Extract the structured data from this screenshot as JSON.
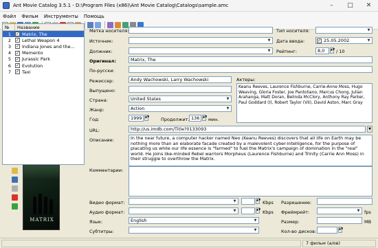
{
  "window": {
    "title": "Ant Movie Catalog 3.5.1 - D:\\Program Files (x86)\\Ant Movie Catalog\\Catalogs\\sample.amc"
  },
  "menu": [
    "Файл",
    "Фильм",
    "Инструменты",
    "Помощь"
  ],
  "list": {
    "headers": {
      "num": "№",
      "name": "Название"
    },
    "rows": [
      {
        "num": "1",
        "checked": "✓",
        "name": "Matrix, The"
      },
      {
        "num": "2",
        "checked": "✓",
        "name": "Lethal Weapon 4"
      },
      {
        "num": "3",
        "checked": "✓",
        "name": "Indiana Jones and the..."
      },
      {
        "num": "4",
        "checked": "✓",
        "name": "Memento"
      },
      {
        "num": "5",
        "checked": "✓",
        "name": "Jurassic Park"
      },
      {
        "num": "6",
        "checked": "✓",
        "name": "Evolution"
      },
      {
        "num": "7",
        "checked": "✓",
        "name": "Taxi"
      }
    ]
  },
  "poster": {
    "title": "MATRIX"
  },
  "form": {
    "media_label": {
      "label": "Метка носителя:",
      "value": ""
    },
    "source": {
      "label": "Источник:",
      "value": ""
    },
    "borrower": {
      "label": "Должник:",
      "value": ""
    },
    "media_type": {
      "label": "Тип носителя:",
      "value": ""
    },
    "date_added": {
      "label": "Дата ввода:",
      "value": "25.05.2002",
      "checked": "✓"
    },
    "rating": {
      "label": "Рейтинг:",
      "value": "8,0",
      "suffix": "/ 10"
    },
    "original": {
      "label": "Оригинал:",
      "value": "Matrix, The"
    },
    "translated": {
      "label": "По-русски:",
      "value": ""
    },
    "director": {
      "label": "Режиссер:",
      "value": "Andy Wachowski, Larry Wachowski"
    },
    "producer": {
      "label": "Выпущено:",
      "value": ""
    },
    "country": {
      "label": "Страна:",
      "value": "United States"
    },
    "genre": {
      "label": "Жанр:",
      "value": "Action"
    },
    "year": {
      "label": "Год:",
      "value": "1999"
    },
    "length": {
      "label": "Продолжит.:",
      "value": "136",
      "unit": "мин."
    },
    "url": {
      "label": "URL:",
      "value": "http://us.imdb.com/Title?0133093"
    },
    "actors": {
      "label": "Актеры:",
      "value": "Keanu Reeves, Laurence Fishburne, Carrie-Anne Moss, Hugo Weaving, Gloria Foster, Joe Pantoliano, Marcus Chong, Julian Arahanga, Matt Doran, Belinda McClory, Anthony Ray Parker, Paul Goddard (I), Robert Taylor (VII), David Aston, Marc Gray"
    },
    "description": {
      "label": "Описание:",
      "value": "In the near future, a computer hacker named Neo (Keanu Reeves) discovers that all life on Earth may be nothing more than an elaborate facade created by a malevolent cyber-intelligence, for the purpose of placating us while our life essence is \"farmed\" to fuel the Matrix's campaign of domination in the \"real\" world. He joins like-minded Rebel warriors Morpheus (Laurence Fishburne) and Trinity (Carrie Ann Moss) in their struggle to overthrow the Matrix."
    },
    "comments": {
      "label": "Комментарии:",
      "value": ""
    },
    "video_format": {
      "label": "Видео формат:",
      "value": "",
      "unit": "Kbps"
    },
    "audio_format": {
      "label": "Аудио формат:",
      "value": "",
      "unit": "Kbps"
    },
    "languages": {
      "label": "Язык:",
      "value": "English"
    },
    "subtitles": {
      "label": "Субтитры:",
      "value": ""
    },
    "resolution": {
      "label": "Разрешение:",
      "value": ""
    },
    "framerate": {
      "label": "Фреймрейт:",
      "value": "",
      "unit": "fps"
    },
    "size": {
      "label": "Размер:",
      "value": "",
      "unit": "MB"
    },
    "discs": {
      "label": "Кол-во дисков:",
      "value": ""
    }
  },
  "status": {
    "count": "7 фильм (a/ов)"
  },
  "colors": {
    "selection": "#316ac5",
    "window_bg": "#ece9d8",
    "field_border": "#7f9db9"
  }
}
